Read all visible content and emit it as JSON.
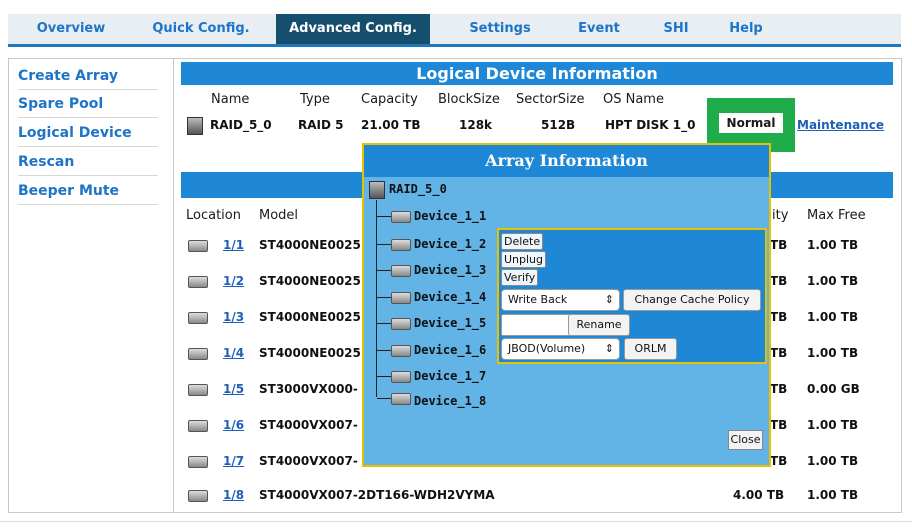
{
  "tabs": [
    "Overview",
    "Quick Config.",
    "Advanced Config.",
    "Settings",
    "Event",
    "SHI",
    "Help"
  ],
  "sidebar": [
    "Create Array",
    "Spare Pool",
    "Logical Device",
    "Rescan",
    "Beeper Mute"
  ],
  "logical": {
    "title": "Logical Device Information",
    "headers": {
      "name": "Name",
      "type": "Type",
      "capacity": "Capacity",
      "blocksize": "BlockSize",
      "sectorsize": "SectorSize",
      "osname": "OS Name"
    },
    "row": {
      "name": "RAID_5_0",
      "type": "RAID 5",
      "capacity": "21.00 TB",
      "blocksize": "128k",
      "sectorsize": "512B",
      "osname": "HPT DISK 1_0",
      "status": "Normal",
      "action": "Maintenance"
    }
  },
  "devices": {
    "headers": {
      "location": "Location",
      "model": "Model",
      "capacity": "ity",
      "maxfree": "Max Free"
    },
    "rows": [
      {
        "loc": "1/1",
        "model": "ST4000NE0025",
        "cap": "TB",
        "free": "1.00 TB"
      },
      {
        "loc": "1/2",
        "model": "ST4000NE0025",
        "cap": "TB",
        "free": "1.00 TB"
      },
      {
        "loc": "1/3",
        "model": "ST4000NE0025",
        "cap": "TB",
        "free": "1.00 TB"
      },
      {
        "loc": "1/4",
        "model": "ST4000NE0025",
        "cap": "TB",
        "free": "1.00 TB"
      },
      {
        "loc": "1/5",
        "model": "ST3000VX000-",
        "cap": "TB",
        "free": "0.00 GB"
      },
      {
        "loc": "1/6",
        "model": "ST4000VX007-",
        "cap": "TB",
        "free": "1.00 TB"
      },
      {
        "loc": "1/7",
        "model": "ST4000VX007-",
        "cap": "TB",
        "free": "1.00 TB"
      },
      {
        "loc": "1/8",
        "model": "ST4000VX007-2DT166-WDH2VYMA",
        "cap": "4.00 TB",
        "free": "1.00 TB"
      }
    ]
  },
  "modal": {
    "title": "Array Information",
    "array": "RAID_5_0",
    "devices": [
      "Device_1_1",
      "Device_1_2",
      "Device_1_3",
      "Device_1_4",
      "Device_1_5",
      "Device_1_6",
      "Device_1_7",
      "Device_1_8"
    ],
    "actions": {
      "delete": "Delete",
      "unplug": "Unplug",
      "verify": "Verify",
      "cache_select": "Write Back",
      "cache_button": "Change Cache Policy",
      "rename_value": "",
      "rename_button": "Rename",
      "jbod_select": "JBOD(Volume)",
      "orlm_button": "ORLM"
    },
    "close": "Close"
  },
  "colors": {
    "accent": "#1e88d6",
    "tab_active": "#164f6e",
    "highlight": "#1fac4a",
    "popup_border": "#e6c200"
  }
}
